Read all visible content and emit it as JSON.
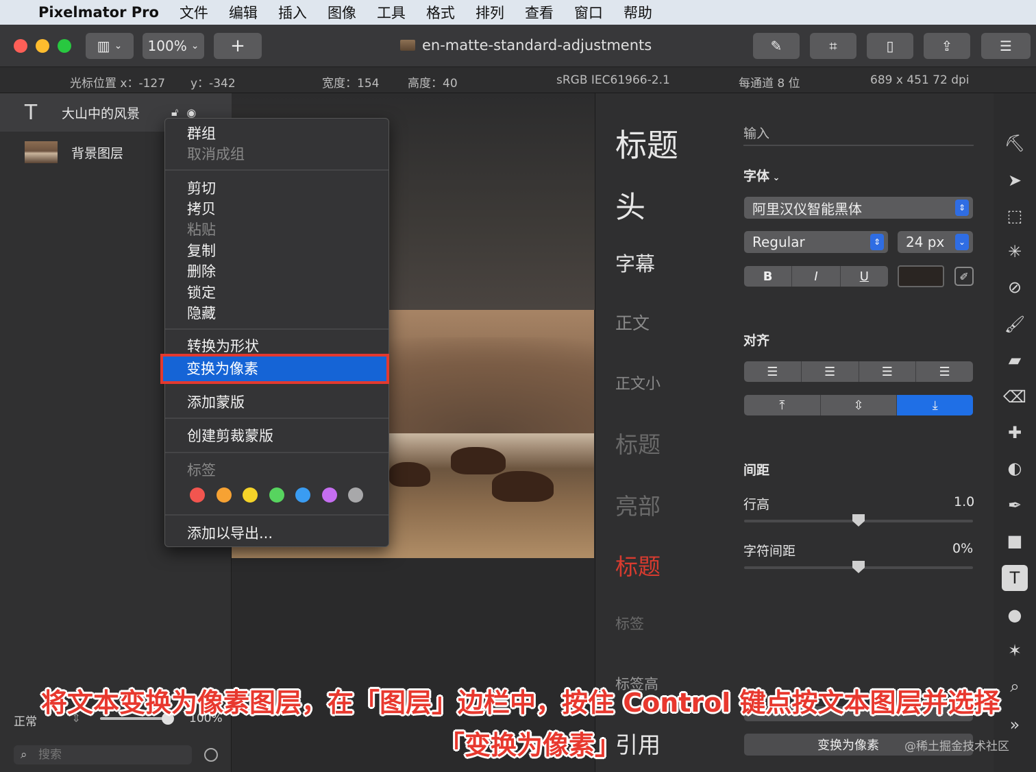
{
  "menubar": {
    "app_name": "Pixelmator Pro",
    "items": [
      "文件",
      "编辑",
      "插入",
      "图像",
      "工具",
      "格式",
      "排列",
      "查看",
      "窗口",
      "帮助"
    ]
  },
  "toolbar": {
    "zoom": "100%",
    "add": "+",
    "document_title": "en-matte-standard-adjustments"
  },
  "infobar": {
    "cursor_label": "光标位置 x：-127",
    "y": "y：-342",
    "width": "宽度：154",
    "height": "高度：40",
    "colorspace": "sRGB IEC61966-2.1",
    "depth": "每通道 8 位",
    "size": "689 x 451 72 dpi"
  },
  "layers": {
    "items": [
      {
        "name": "大山中的风景",
        "icon": "text-layer-icon"
      },
      {
        "name": "背景图层",
        "icon": "image-layer-icon"
      }
    ],
    "blend_mode": "正常",
    "opacity": "100%",
    "search_placeholder": "搜索"
  },
  "context_menu": {
    "group": "群组",
    "ungroup": "取消成组",
    "cut": "剪切",
    "copy": "拷贝",
    "paste": "粘贴",
    "duplicate": "复制",
    "delete": "删除",
    "lock": "锁定",
    "hide": "隐藏",
    "convert_to_shape": "转换为形状",
    "convert_to_pixels": "变换为像素",
    "add_mask": "添加蒙版",
    "create_clipping_mask": "创建剪裁蒙版",
    "tags_label": "标签",
    "tag_colors": [
      "#f2554f",
      "#f7a233",
      "#f5d329",
      "#57d45f",
      "#3a9cf2",
      "#c56ef0",
      "#a8a8aa"
    ],
    "add_to_export": "添加以导出..."
  },
  "text_styles": [
    {
      "label": "标题",
      "style": "title"
    },
    {
      "label": "头",
      "style": "headline"
    },
    {
      "label": "字幕",
      "style": "subtitle"
    },
    {
      "label": "正文",
      "style": "body"
    },
    {
      "label": "正文小",
      "style": "small"
    },
    {
      "label": "标题",
      "style": "heading-dim"
    },
    {
      "label": "亮部",
      "style": "highlight"
    },
    {
      "label": "标题",
      "style": "heading-red"
    },
    {
      "label": "标签",
      "style": "tag"
    },
    {
      "label": "标签高",
      "style": "tag-high"
    },
    {
      "label": "引用",
      "style": "quote"
    }
  ],
  "inspector": {
    "input_label": "输入",
    "font_label": "字体",
    "font_family": "阿里汉仪智能黑体",
    "font_weight": "Regular",
    "font_size": "24 px",
    "bold": "B",
    "italic": "I",
    "underline": "U",
    "text_color": "#2a2522",
    "align_label": "对齐",
    "spacing_label": "间距",
    "line_height_label": "行高",
    "line_height_value": "1.0",
    "line_height_fraction": 0.5,
    "char_spacing_label": "字符间距",
    "char_spacing_value": "0%",
    "char_spacing_fraction": 0.5,
    "convert_to_pixels_button": "变换为像素"
  },
  "caption": {
    "line1": "将文本变换为像素图层，在「图层」边栏中，按住 Control 键点按文本图层并选择",
    "line2": "「变换为像素」"
  },
  "watermark": "@稀土掘金技术社区"
}
